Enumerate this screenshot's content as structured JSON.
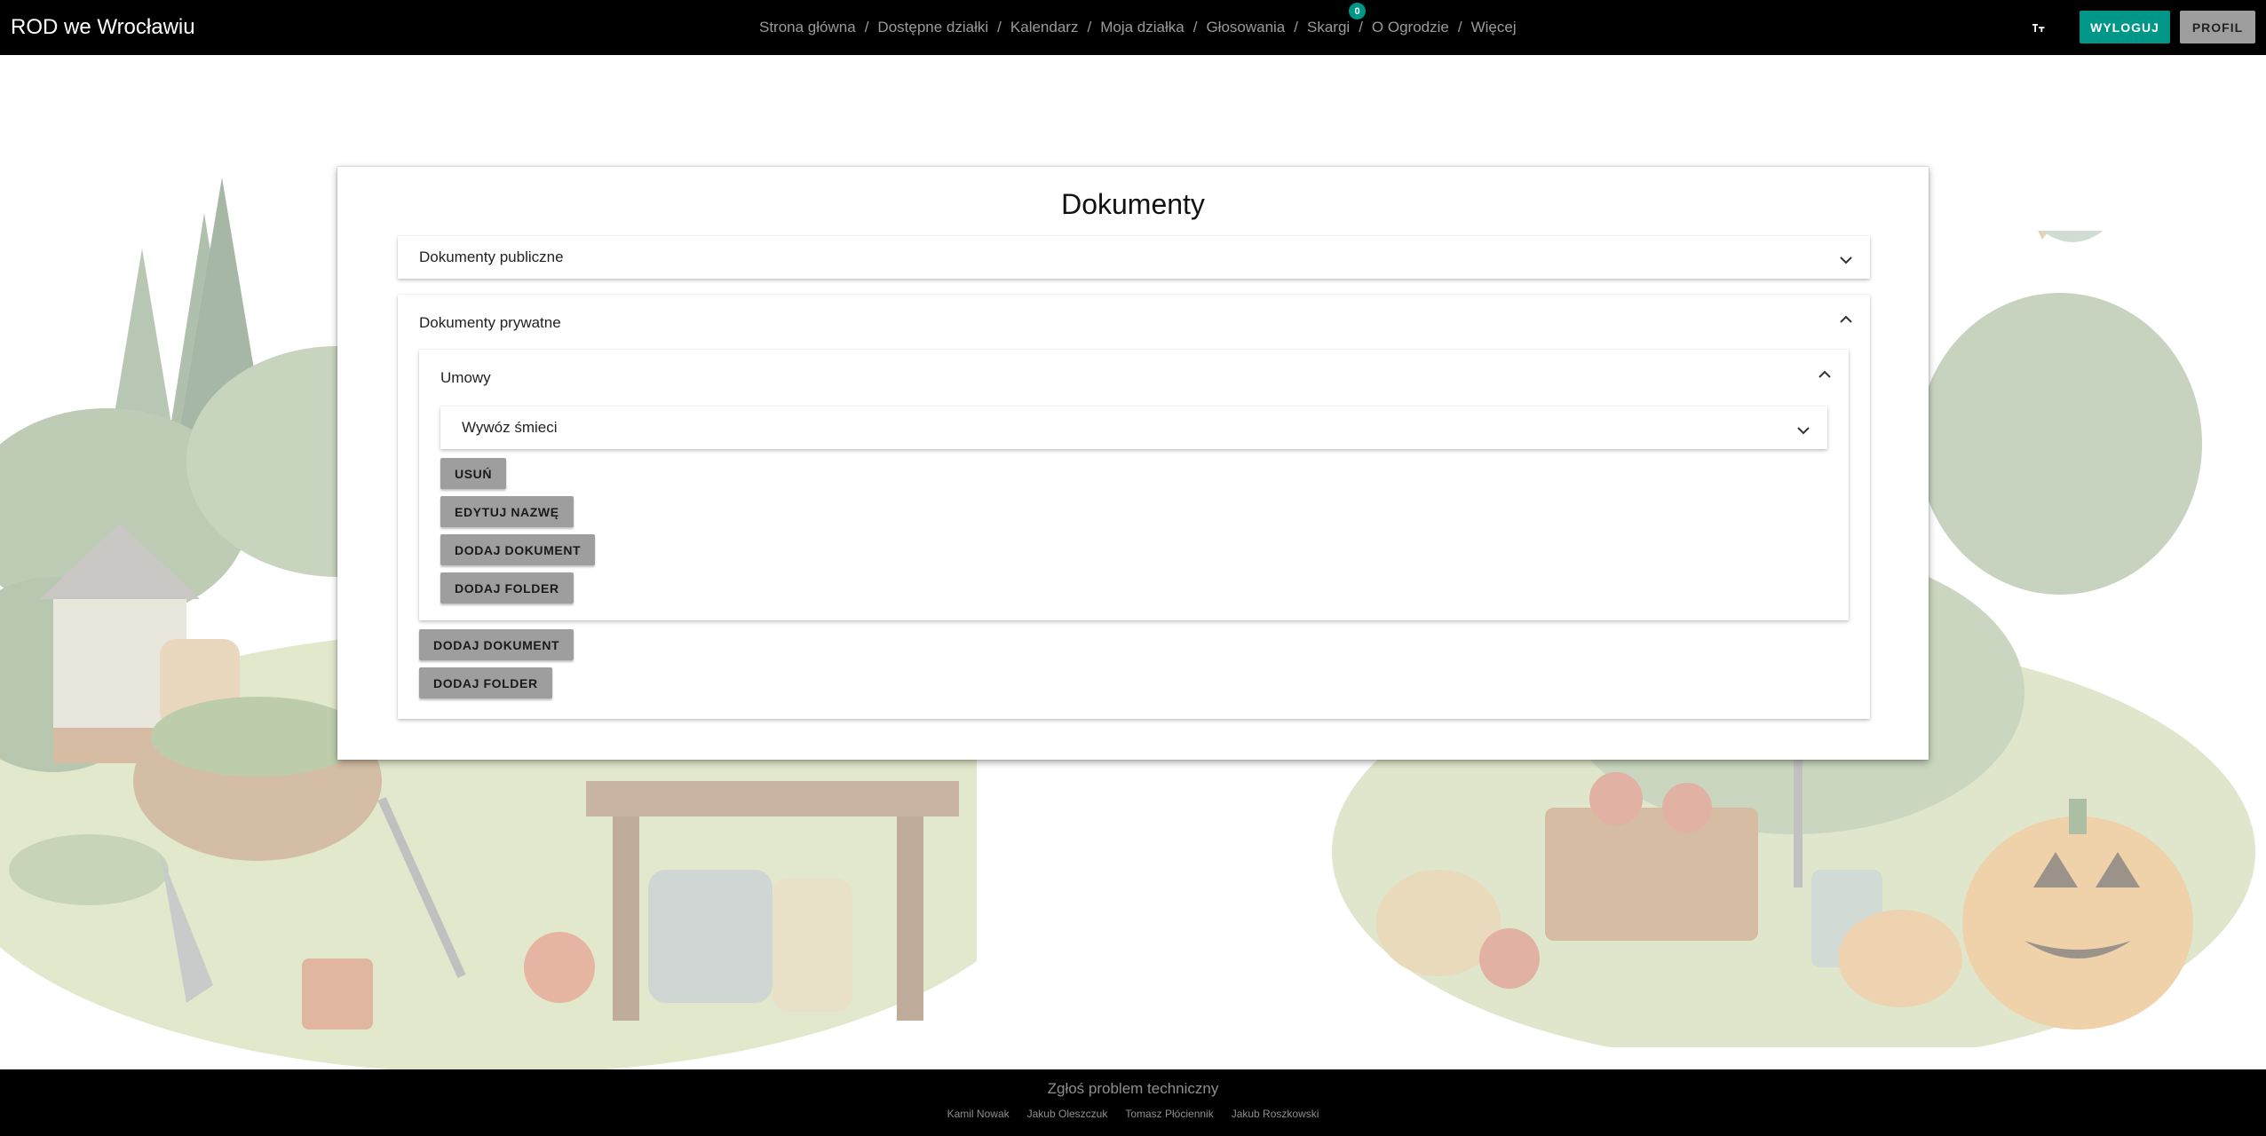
{
  "header": {
    "brand": "ROD we Wrocławiu",
    "nav": [
      {
        "label": "Strona główna"
      },
      {
        "label": "Dostępne działki"
      },
      {
        "label": "Kalendarz"
      },
      {
        "label": "Moja działka"
      },
      {
        "label": "Głosowania"
      },
      {
        "label": "Skargi",
        "badge": "0"
      },
      {
        "label": "O Ogrodzie"
      },
      {
        "label": "Więcej"
      }
    ],
    "separator": "/",
    "font_size_icon": "text-size-icon",
    "logout_label": "WYLOGUJ",
    "profile_label": "PROFIL"
  },
  "main": {
    "title": "Dokumenty",
    "public_panel": {
      "label": "Dokumenty publiczne",
      "expanded": false
    },
    "private_panel": {
      "label": "Dokumenty prywatne",
      "expanded": true,
      "folder": {
        "label": "Umowy",
        "expanded": true,
        "subfolder": {
          "label": "Wywóz śmieci",
          "expanded": false
        },
        "buttons": {
          "delete": "USUŃ",
          "rename": "EDYTUJ NAZWĘ",
          "add_document": "DODAJ DOKUMENT",
          "add_folder": "DODAJ FOLDER"
        }
      },
      "buttons": {
        "add_document": "DODAJ DOKUMENT",
        "add_folder": "DODAJ FOLDER"
      }
    }
  },
  "footer": {
    "report_link": "Zgłoś problem techniczny",
    "authors": [
      "Kamil Nowak",
      "Jakub Oleszczuk",
      "Tomasz Płóciennik",
      "Jakub Roszkowski"
    ]
  },
  "colors": {
    "accent": "#009688",
    "button_grey": "#9e9e9e",
    "bar_black": "#000000"
  }
}
